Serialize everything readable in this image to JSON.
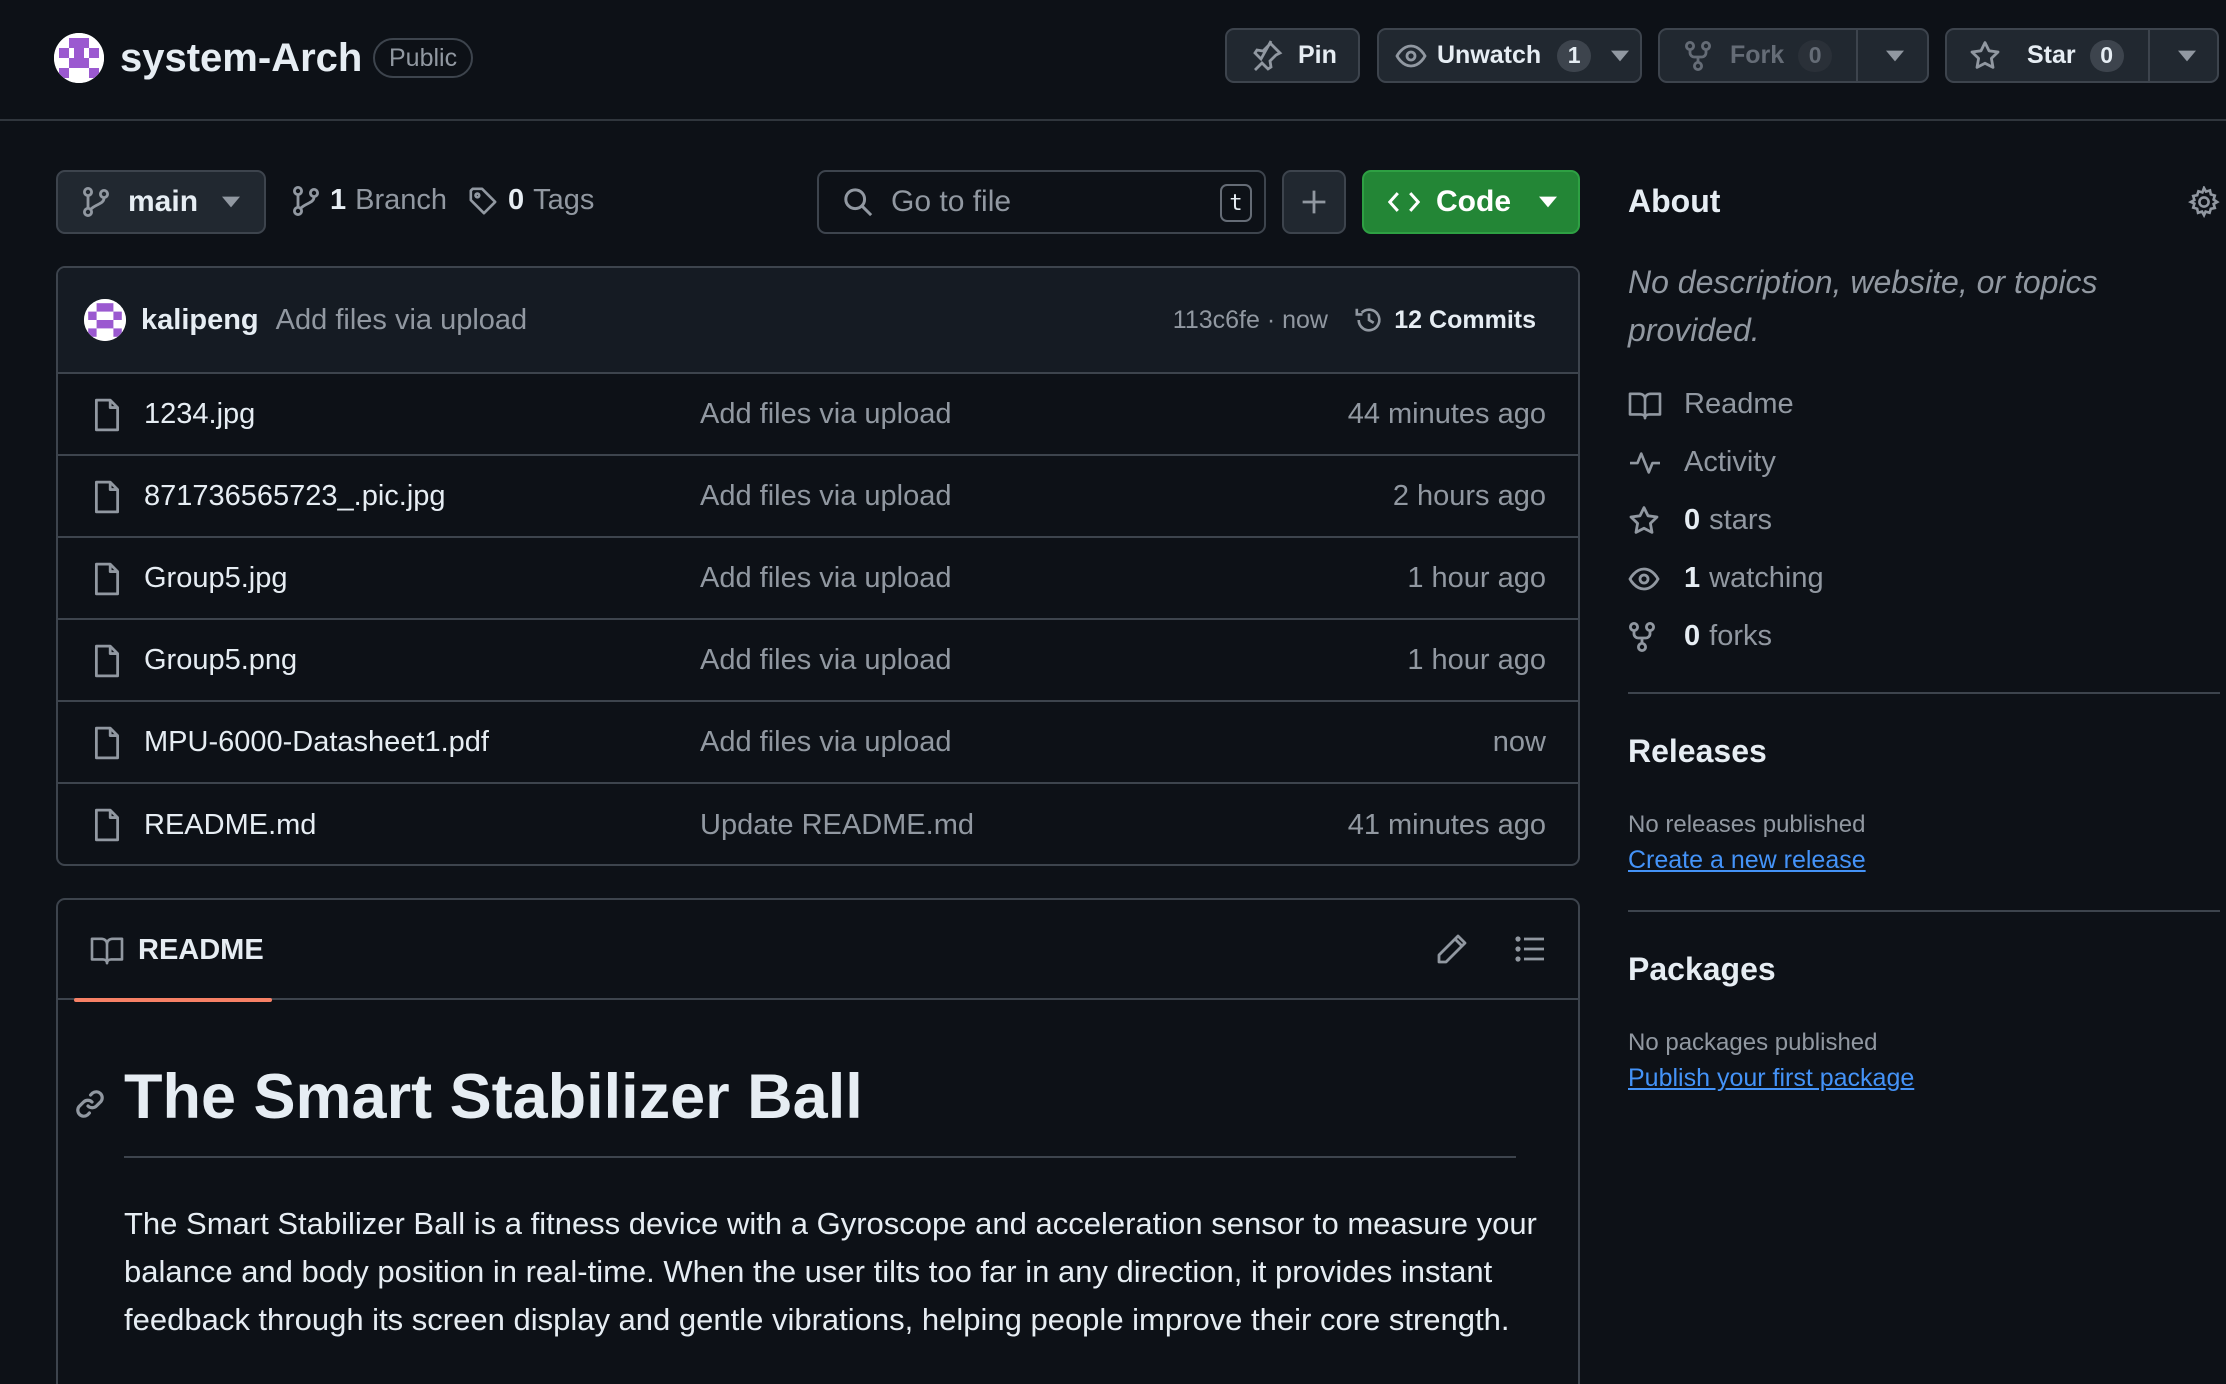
{
  "repo": {
    "name": "system-Arch",
    "visibility": "Public"
  },
  "header_actions": {
    "pin_label": "Pin",
    "unwatch_label": "Unwatch",
    "unwatch_count": "1",
    "fork_label": "Fork",
    "fork_count": "0",
    "star_label": "Star",
    "star_count": "0"
  },
  "toolbar": {
    "branch": "main",
    "branch_count": "1",
    "branch_label": "Branch",
    "tag_count": "0",
    "tag_label": "Tags",
    "search_placeholder": "Go to file",
    "search_shortcut": "t",
    "code_label": "Code"
  },
  "latest_commit": {
    "user": "kalipeng",
    "message": "Add files via upload",
    "sha_time": "113c6fe · now",
    "commits_label": "12 Commits"
  },
  "files": [
    {
      "name": "1234.jpg",
      "message": "Add files via upload",
      "time": "44 minutes ago"
    },
    {
      "name": "871736565723_.pic.jpg",
      "message": "Add files via upload",
      "time": "2 hours ago"
    },
    {
      "name": "Group5.jpg",
      "message": "Add files via upload",
      "time": "1 hour ago"
    },
    {
      "name": "Group5.png",
      "message": "Add files via upload",
      "time": "1 hour ago"
    },
    {
      "name": "MPU-6000-Datasheet1.pdf",
      "message": "Add files via upload",
      "time": "now"
    },
    {
      "name": "README.md",
      "message": "Update README.md",
      "time": "41 minutes ago"
    }
  ],
  "readme": {
    "tab_label": "README",
    "title": "The Smart Stabilizer Ball",
    "paragraph": "The Smart Stabilizer Ball is a fitness device with a Gyroscope and acceleration sensor to measure your balance and body position in real-time. When the user tilts too far in any direction, it provides instant feedback through its screen display and gentle vibrations, helping people improve their core strength."
  },
  "sidebar": {
    "about_title": "About",
    "description": "No description, website, or topics provided.",
    "readme_label": "Readme",
    "activity_label": "Activity",
    "stars_count": "0",
    "stars_label": "stars",
    "watching_count": "1",
    "watching_label": "watching",
    "forks_count": "0",
    "forks_label": "forks",
    "releases_title": "Releases",
    "releases_text": "No releases published",
    "releases_link": "Create a new release",
    "packages_title": "Packages",
    "packages_text": "No packages published",
    "packages_link": "Publish your first package"
  },
  "colors": {
    "background": "#0d1117",
    "border": "#3d444d",
    "code_button": "#238636",
    "link": "#4493f8",
    "tab_underline": "#f78166"
  }
}
